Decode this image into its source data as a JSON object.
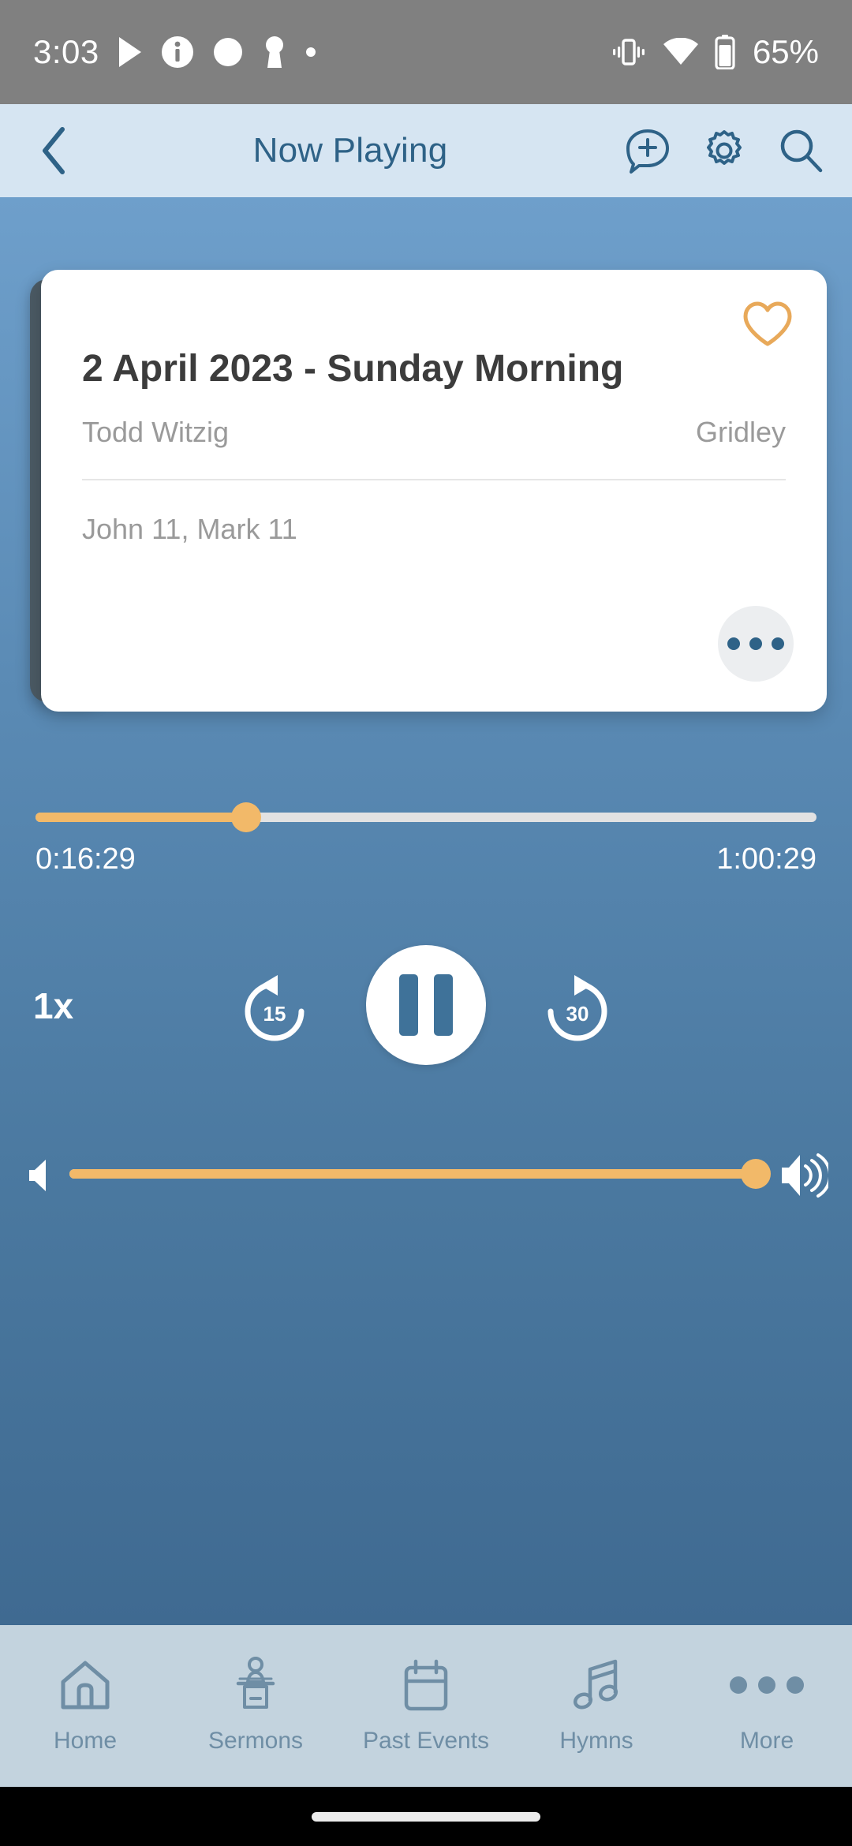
{
  "status_bar": {
    "clock": "3:03",
    "battery_percent": "65%",
    "left_icons": [
      "play-icon",
      "info-icon",
      "record-circle-icon",
      "keyhole-icon",
      "small-dot-icon"
    ],
    "right_icons": [
      "vibrate-icon",
      "wifi-icon",
      "battery-icon"
    ],
    "background_color": "#808080"
  },
  "app_bar": {
    "back_label": "‹",
    "title": "Now Playing",
    "actions": [
      {
        "name": "add-comment-icon",
        "label": "Add note"
      },
      {
        "name": "gear-icon",
        "label": "Settings"
      },
      {
        "name": "search-icon",
        "label": "Search"
      }
    ],
    "background_color": "#d6e5f2",
    "text_color": "#2e6287"
  },
  "now_playing_card": {
    "title": "2 April 2023 - Sunday Morning",
    "speaker": "Todd Witzig",
    "location": "Gridley",
    "scripture_references": "John 11, Mark 11",
    "favorite_icon": "heart-outline-icon",
    "favorite_active": false,
    "favorite_color": "#e8a95a",
    "overflow_icon": "more-horizontal-icon"
  },
  "player": {
    "elapsed_time": "0:16:29",
    "total_time": "1:00:29",
    "progress_percent": 27,
    "speed_label": "1x",
    "rewind_label": "15",
    "forward_label": "30",
    "play_state": "playing",
    "play_button_icon": "pause-icon",
    "rewind_icon": "replay-15-icon",
    "forward_icon": "forward-30-icon",
    "accent_color": "#f2b969",
    "track_color": "#e2e2e2"
  },
  "volume": {
    "level_percent": 100,
    "low_icon": "volume-low-icon",
    "high_icon": "volume-high-icon"
  },
  "bottom_nav": {
    "items": [
      {
        "label": "Home",
        "icon": "home-icon"
      },
      {
        "label": "Sermons",
        "icon": "pulpit-icon"
      },
      {
        "label": "Past Events",
        "icon": "calendar-icon"
      },
      {
        "label": "Hymns",
        "icon": "music-note-icon"
      },
      {
        "label": "More",
        "icon": "more-horizontal-icon"
      }
    ],
    "background_color": "#c3d3de",
    "text_color": "#6f8ea5"
  },
  "theme": {
    "gradient_top": "#6e9fcb",
    "gradient_bottom": "#3f6a91",
    "accent": "#f2b969",
    "primary": "#2e6287"
  }
}
